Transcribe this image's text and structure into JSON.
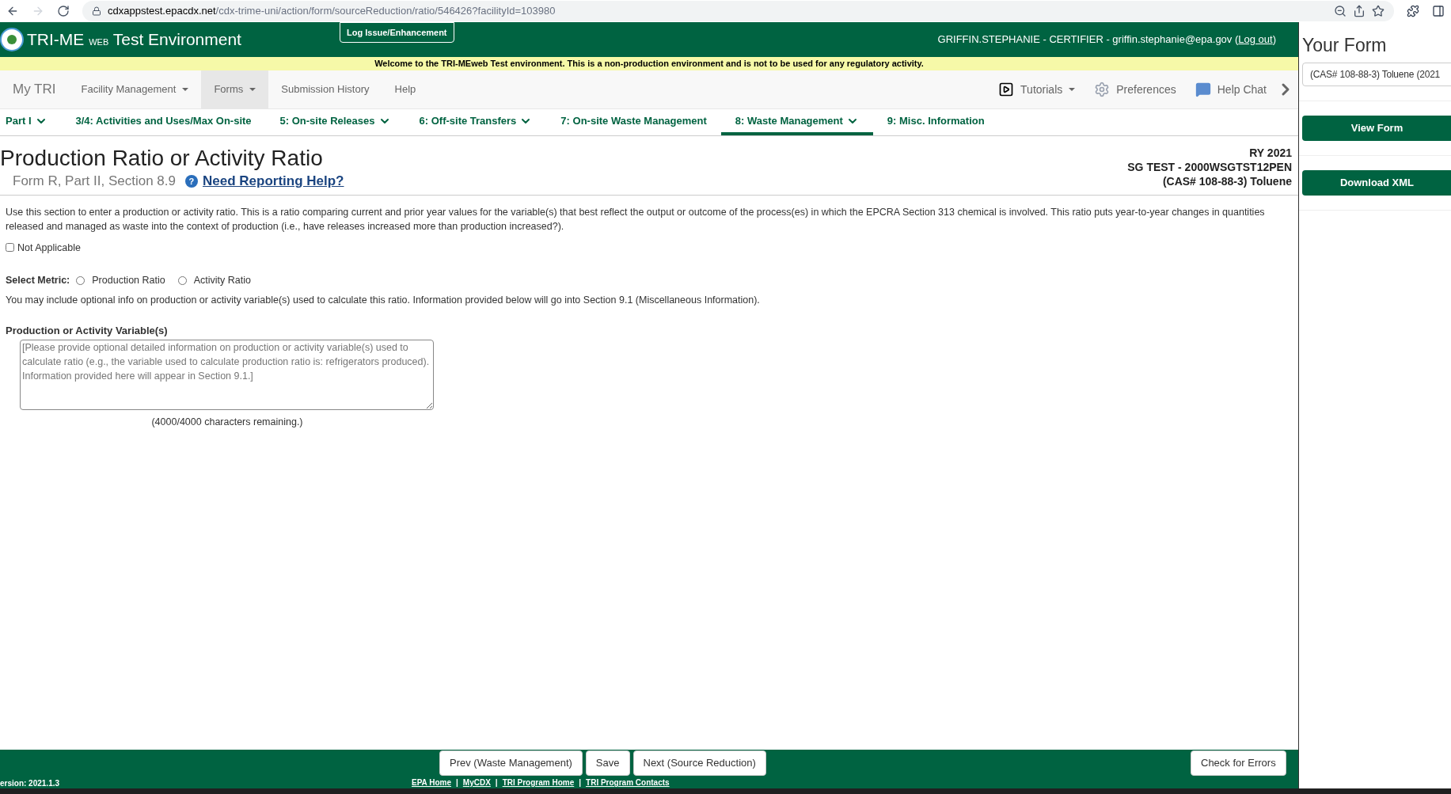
{
  "browser": {
    "url_host": "cdxappstest.epacdx.net",
    "url_path": "/cdx-trime-uni/action/form/sourceReduction/ratio/546426?facilityId=103980"
  },
  "header": {
    "title_main": "TRI-ME",
    "title_small": "WEB",
    "title_rest": "Test Environment",
    "issue_button": "Log Issue/Enhancement",
    "user": "GRIFFIN.STEPHANIE - CERTIFIER - griffin.stephanie@epa.gov (",
    "logout": "Log out",
    "user_end": ")"
  },
  "banner": "Welcome to the TRI-MEweb Test environment. This is a non-production environment and is not to be used for any regulatory activity.",
  "nav": {
    "items": [
      {
        "label": "My TRI",
        "kind": "brand",
        "has_menu": false,
        "selected": false
      },
      {
        "label": "Facility Management",
        "kind": "menu",
        "has_menu": true,
        "selected": false
      },
      {
        "label": "Forms",
        "kind": "menu",
        "has_menu": true,
        "selected": true
      },
      {
        "label": "Submission History",
        "kind": "menu",
        "has_menu": false,
        "selected": false
      },
      {
        "label": "Help",
        "kind": "menu",
        "has_menu": false,
        "selected": false
      }
    ],
    "tools": [
      {
        "label": "Tutorials",
        "kind": "video",
        "has_menu": true
      },
      {
        "label": "Preferences",
        "kind": "gear",
        "has_menu": false
      },
      {
        "label": "Help Chat",
        "kind": "chat",
        "has_menu": false
      }
    ]
  },
  "tabs": [
    {
      "label": "Part I",
      "has_menu": true,
      "selected": false
    },
    {
      "label": "3/4: Activities and Uses/Max On-site",
      "has_menu": false,
      "selected": false
    },
    {
      "label": "5: On-site Releases",
      "has_menu": true,
      "selected": false
    },
    {
      "label": "6: Off-site Transfers",
      "has_menu": true,
      "selected": false
    },
    {
      "label": "7: On-site Waste Management",
      "has_menu": false,
      "selected": false
    },
    {
      "label": "8: Waste Management",
      "has_menu": true,
      "selected": true
    },
    {
      "label": "9: Misc. Information",
      "has_menu": false,
      "selected": false
    }
  ],
  "page": {
    "title": "Production Ratio or Activity Ratio",
    "subtitle": "Form R, Part II, Section 8.9",
    "help_icon": "?",
    "help_link": "Need Reporting Help?",
    "info": [
      "RY 2021",
      "SG TEST - 2000WSGTST12PEN",
      "(CAS# 108-88-3) Toluene"
    ]
  },
  "form": {
    "description": "Use this section to enter a production or activity ratio. This is a ratio comparing current and prior year values for the variable(s) that best reflect the output or outcome of the process(es) in which the EPCRA Section 313 chemical is involved. This ratio puts year-to-year changes in quantities released and managed as waste into the context of production (i.e., have releases increased more than production increased?).",
    "not_applicable": {
      "label": "Not Applicable",
      "checked": false
    },
    "metric_label": "Select Metric:",
    "metrics": [
      {
        "label": "Production Ratio",
        "selected": false
      },
      {
        "label": "Activity Ratio",
        "selected": false
      }
    ],
    "note": "You may include optional info on production or activity variable(s) used to calculate this ratio. Information provided below will go into Section 9.1 (Miscellaneous Information).",
    "variable_label": "Production or Activity Variable(s)",
    "placeholder": "[Please provide optional detailed information on production or activity variable(s) used to calculate ratio (e.g., the variable used to calculate production ratio is: refrigerators produced). Information provided here will appear in Section 9.1.]",
    "remaining": "(4000/4000 characters remaining.)"
  },
  "footer": {
    "buttons": [
      "Prev (Waste Management)",
      "Save",
      "Next (Source Reduction)"
    ],
    "check_button": "Check for Errors",
    "version": "ersion: 2021.1.3",
    "links": [
      {
        "label": "EPA Home"
      },
      {
        "prefix": "|",
        "label": "MyCDX"
      },
      {
        "prefix": "|",
        "label": "TRI Program Home"
      },
      {
        "prefix": "|",
        "label": "TRI Program Contacts"
      }
    ]
  },
  "sidebar": {
    "title": "Your Form",
    "selector": "(CAS# 108-88-3) Toluene (2021",
    "buttons": [
      "View Form",
      "Download XML"
    ]
  }
}
